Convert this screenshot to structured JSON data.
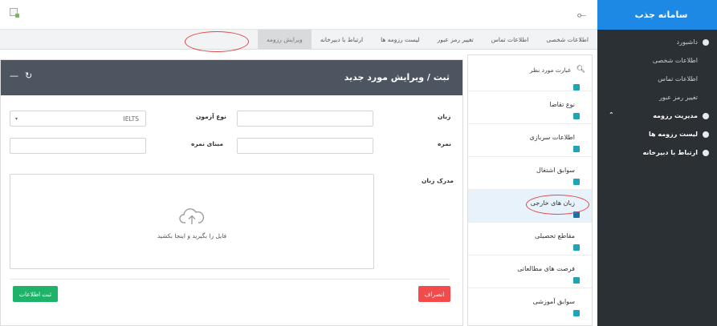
{
  "sidebar": {
    "brand": "سامانه جذب",
    "items": [
      {
        "label": "داشبورد"
      },
      {
        "label": "اطلاعات شخصی"
      },
      {
        "label": "اطلاعات تماس"
      },
      {
        "label": "تغییر رمز عبور"
      },
      {
        "label": "مدیریت رزومه"
      },
      {
        "label": "لیست رزومه ها"
      },
      {
        "label": "ارتباط با دبیرخانه"
      }
    ]
  },
  "topbar": {
    "toggle_glyph": "⟜"
  },
  "tabs": [
    {
      "label": "اطلاعات شخصی"
    },
    {
      "label": "اطلاعات تماس"
    },
    {
      "label": "تغییر رمز عبور"
    },
    {
      "label": "لیست رزومه ها"
    },
    {
      "label": "ارتباط با دبیرخانه"
    },
    {
      "label": "ویرایش رزومه"
    }
  ],
  "list": {
    "search_placeholder": "عبارت مورد نظر",
    "items": [
      {
        "label": "نوع تقاضا"
      },
      {
        "label": "اطلاعات سربازی"
      },
      {
        "label": "سوابق اشتغال"
      },
      {
        "label": "زبان های خارجی"
      },
      {
        "label": "مقاطع تحصیلی"
      },
      {
        "label": "فرصت های مطالعاتی"
      },
      {
        "label": "سوابق آموزشی"
      }
    ]
  },
  "form": {
    "title": "ثبت / ویرایش مورد جدید",
    "language_label": "زبان",
    "exam_type_label": "نوع آزمون",
    "exam_type_value": "IELTS",
    "score_label": "نمره",
    "score_base_label": "مبنای نمره",
    "certificate_label": "مدرک زبان",
    "dropzone_text": "فایل را بگیرید و اینجا بکشید",
    "cancel_label": "انصراف",
    "save_label": "ثبت اطلاعات"
  },
  "colors": {
    "sidebar_bg": "#2b3035",
    "brand_bg": "#1e88e5",
    "card_header": "#4d5660",
    "cancel": "#f24b4b",
    "save": "#1fb36a",
    "badge": "#1fa3b5",
    "annotation": "#e04848"
  }
}
